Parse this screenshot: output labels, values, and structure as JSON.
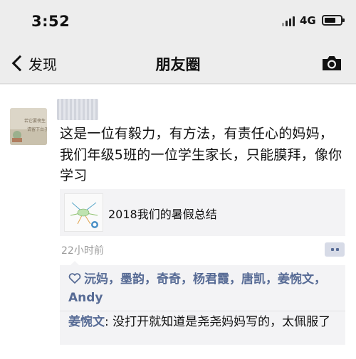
{
  "status": {
    "time": "3:52",
    "network": "4G"
  },
  "nav": {
    "back_label": "发现",
    "title": "朋友圈"
  },
  "post": {
    "avatar_text": "若它要傍生\n请留下台子",
    "text": "这是一位有毅力，有方法，有责任心的妈妈，我们年级5班的一位学生家长，只能膜拜，像你学习",
    "link_title": "2018我们的暑假总结",
    "time": "22小时前",
    "likes": [
      "沅妈",
      "墨韵",
      "奇奇",
      "杨君霞",
      "唐凯",
      "姜惋文",
      "Andy"
    ],
    "comment": {
      "author": "姜惋文",
      "separator": ": ",
      "text": "没打开就知道是尧尧妈妈写的，太佩服了"
    }
  },
  "icons": {
    "back": "chevron-left-icon",
    "camera": "camera-icon",
    "heart": "heart-icon",
    "comment": "comment-icon"
  },
  "colors": {
    "link_blue": "#576b95",
    "time_gray": "#9a9a9a",
    "card_bg": "#f3f3f5"
  }
}
